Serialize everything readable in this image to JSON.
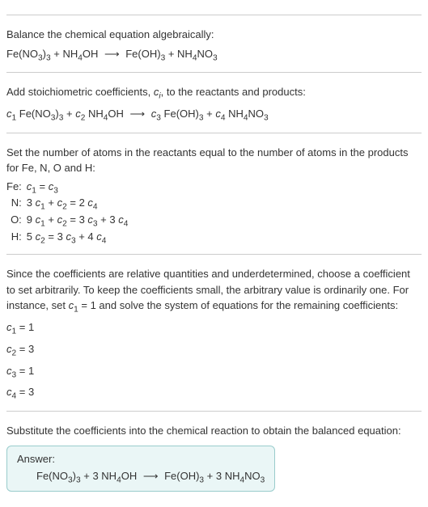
{
  "intro": {
    "line1": "Balance the chemical equation algebraically:",
    "equation_html": "Fe(NO<span class='sub'>3</span>)<span class='sub'>3</span> + NH<span class='sub'>4</span>OH <span class='arrow'>⟶</span> Fe(OH)<span class='sub'>3</span> + NH<span class='sub'>4</span>NO<span class='sub'>3</span>"
  },
  "step1": {
    "text_html": "Add stoichiometric coefficients, <i>c<span class='sub'>i</span></i>, to the reactants and products:",
    "equation_html": "<i>c</i><span class='sub'>1</span> Fe(NO<span class='sub'>3</span>)<span class='sub'>3</span> + <i>c</i><span class='sub'>2</span> NH<span class='sub'>4</span>OH <span class='arrow'>⟶</span> <i>c</i><span class='sub'>3</span> Fe(OH)<span class='sub'>3</span> + <i>c</i><span class='sub'>4</span> NH<span class='sub'>4</span>NO<span class='sub'>3</span>"
  },
  "step2": {
    "text": "Set the number of atoms in the reactants equal to the number of atoms in the products for Fe, N, O and H:",
    "rows": [
      {
        "elem": "Fe:",
        "eq_html": "<i>c</i><span class='sub'>1</span> = <i>c</i><span class='sub'>3</span>"
      },
      {
        "elem": "N:",
        "eq_html": "3 <i>c</i><span class='sub'>1</span> + <i>c</i><span class='sub'>2</span> = 2 <i>c</i><span class='sub'>4</span>"
      },
      {
        "elem": "O:",
        "eq_html": "9 <i>c</i><span class='sub'>1</span> + <i>c</i><span class='sub'>2</span> = 3 <i>c</i><span class='sub'>3</span> + 3 <i>c</i><span class='sub'>4</span>"
      },
      {
        "elem": "H:",
        "eq_html": "5 <i>c</i><span class='sub'>2</span> = 3 <i>c</i><span class='sub'>3</span> + 4 <i>c</i><span class='sub'>4</span>"
      }
    ]
  },
  "step3": {
    "text_html": "Since the coefficients are relative quantities and underdetermined, choose a coefficient to set arbitrarily. To keep the coefficients small, the arbitrary value is ordinarily one. For instance, set <i>c</i><span class='sub'>1</span> = 1 and solve the system of equations for the remaining coefficients:",
    "solutions_html": [
      "<i>c</i><span class='sub'>1</span> = 1",
      "<i>c</i><span class='sub'>2</span> = 3",
      "<i>c</i><span class='sub'>3</span> = 1",
      "<i>c</i><span class='sub'>4</span> = 3"
    ]
  },
  "step4": {
    "text": "Substitute the coefficients into the chemical reaction to obtain the balanced equation:"
  },
  "answer": {
    "label": "Answer:",
    "equation_html": "Fe(NO<span class='sub'>3</span>)<span class='sub'>3</span> + 3 NH<span class='sub'>4</span>OH <span class='arrow'>⟶</span> Fe(OH)<span class='sub'>3</span> + 3 NH<span class='sub'>4</span>NO<span class='sub'>3</span>"
  }
}
